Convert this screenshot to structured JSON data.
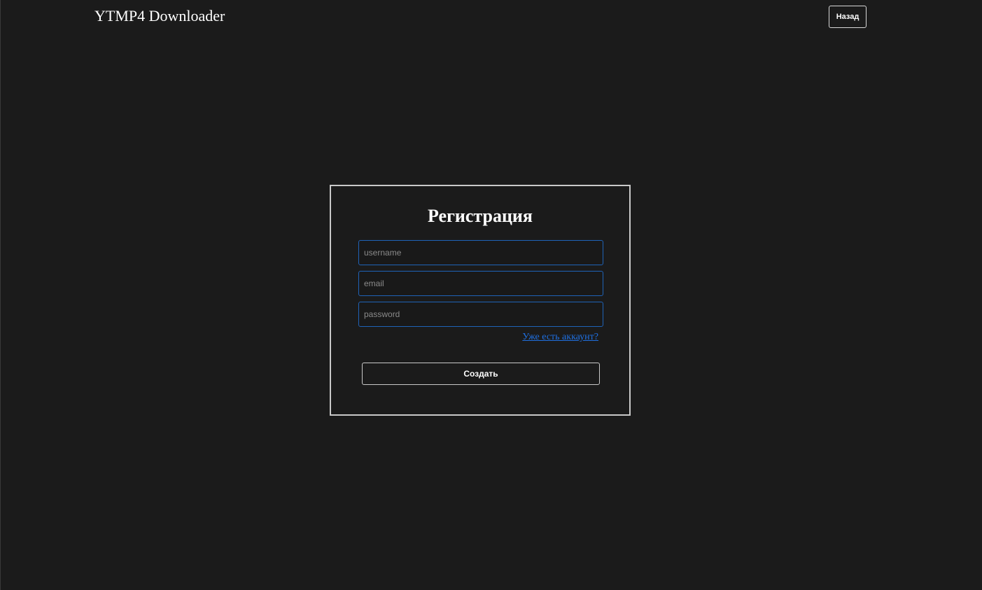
{
  "header": {
    "brand": "YTMP4 Downloader",
    "back_label": "Назад"
  },
  "register_form": {
    "title": "Регистрация",
    "fields": {
      "username": {
        "value": "",
        "placeholder": "username"
      },
      "email": {
        "value": "",
        "placeholder": "email"
      },
      "password": {
        "value": "",
        "placeholder": "password"
      }
    },
    "login_link": "Уже есть аккаунт?",
    "submit_label": "Создать"
  },
  "colors": {
    "background": "#1b1b1b",
    "text": "#ffffff",
    "input_border": "#1f63b8",
    "link": "#1f6fe0",
    "card_border": "#c9c9c9"
  }
}
